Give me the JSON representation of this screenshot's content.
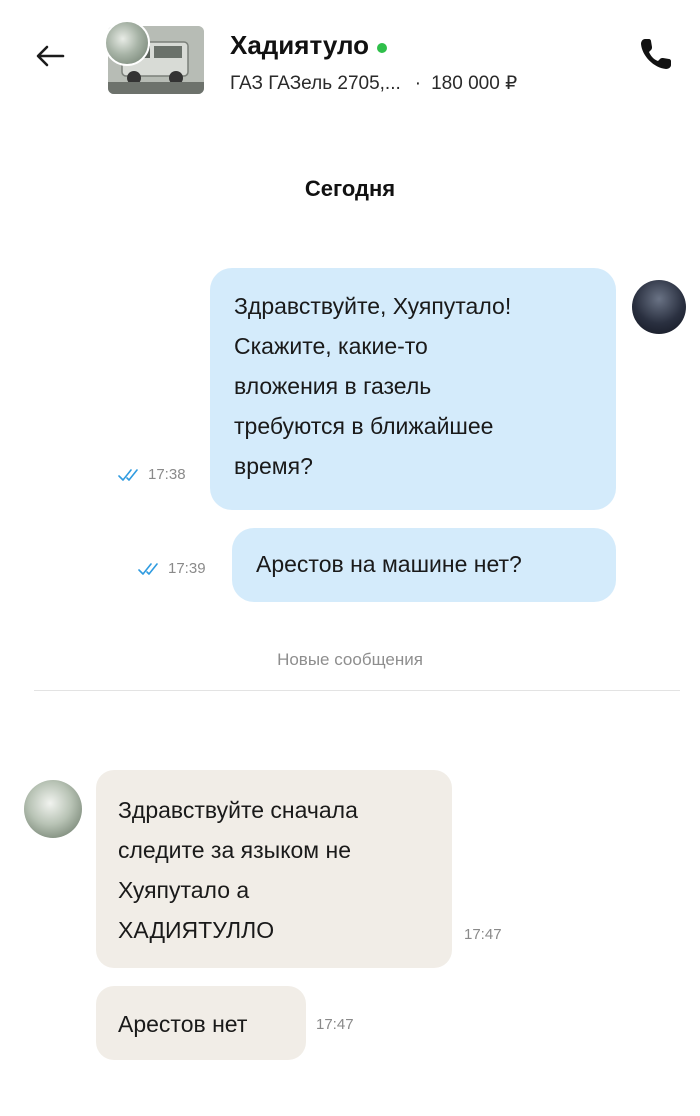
{
  "header": {
    "name": "Хадиятуло",
    "listing_title": "ГАЗ ГАЗель 2705,...",
    "separator": "·",
    "price": "180 000 ₽",
    "online_color": "#2fbf4a"
  },
  "chat": {
    "day_label": "Сегодня",
    "new_messages_label": "Новые сообщения",
    "messages": [
      {
        "direction": "outgoing",
        "lines": [
          "Здравствуйте, Хуяпутало!",
          "Скажите, какие-то",
          "вложения в газель",
          "требуются в ближайшее",
          "время?"
        ],
        "time": "17:38",
        "status": "read"
      },
      {
        "direction": "outgoing",
        "lines": [
          "Арестов на машине нет?"
        ],
        "time": "17:39",
        "status": "read"
      },
      {
        "direction": "incoming",
        "lines": [
          "Здравствуйте сначала",
          "следите за языком не",
          "Хуяпутало а",
          "ХАДИЯТУЛЛО"
        ],
        "time": "17:47"
      },
      {
        "direction": "incoming",
        "lines": [
          "Арестов нет"
        ],
        "time": "17:47"
      }
    ]
  },
  "colors": {
    "outgoing_bubble": "#d4ebfb",
    "incoming_bubble": "#f1ede7",
    "read_check": "#2f9be0"
  },
  "icons": {
    "back": "arrow-left-icon",
    "call": "phone-icon",
    "read_status": "double-check-icon"
  }
}
